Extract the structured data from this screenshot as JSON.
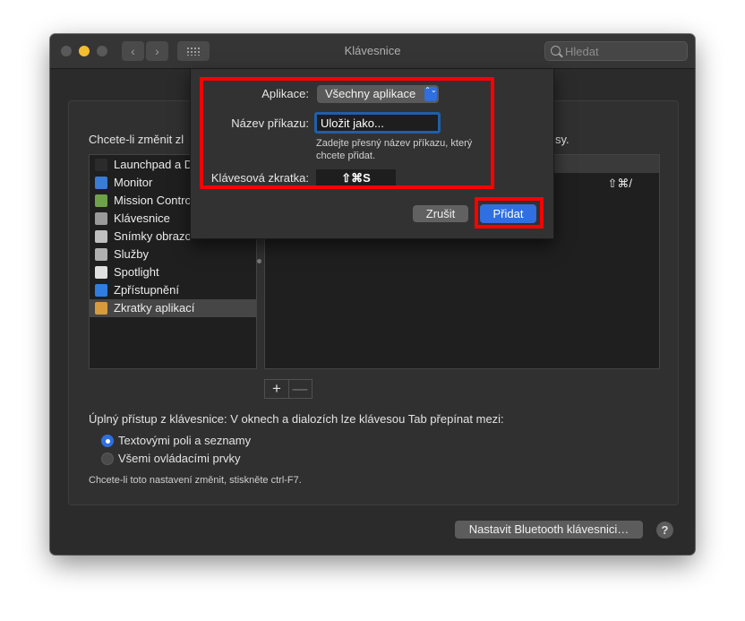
{
  "window": {
    "title": "Klávesnice",
    "search_placeholder": "Hledat",
    "nav_back": "‹",
    "nav_forward": "›"
  },
  "panel": {
    "hint_start": "Chcete-li změnit zl",
    "hint_end": "sy.",
    "sidebar_items": [
      {
        "label": "Launchpad a D",
        "icon": "launchpad-icon",
        "color": "#2b2b2b"
      },
      {
        "label": "Monitor",
        "icon": "monitor-icon",
        "color": "#3a7bd5"
      },
      {
        "label": "Mission Contro",
        "icon": "mission-control-icon",
        "color": "#6fa04a"
      },
      {
        "label": "Klávesnice",
        "icon": "keyboard-icon",
        "color": "#9a9a9a"
      },
      {
        "label": "Snímky obrazo",
        "icon": "screenshot-icon",
        "color": "#c0c0c0"
      },
      {
        "label": "Služby",
        "icon": "services-gear-icon",
        "color": "#b0b0b0"
      },
      {
        "label": "Spotlight",
        "icon": "spotlight-icon",
        "color": "#e0e0e0"
      },
      {
        "label": "Zpřístupnění",
        "icon": "accessibility-icon",
        "color": "#2f7de1"
      },
      {
        "label": "Zkratky aplikací",
        "icon": "app-shortcuts-icon",
        "color": "#d79b3c"
      }
    ],
    "selected_index": 8,
    "detail_shortcut": "⇧⌘/",
    "plus": "+",
    "minus": "—"
  },
  "keyboard_access": {
    "heading": "Úplný přístup z klávesnice: V oknech a dialozích lze klávesou Tab přepínat mezi:",
    "option1": "Textovými poli a seznamy",
    "option2": "Všemi ovládacími prvky",
    "selected": 1,
    "note": "Chcete-li toto nastavení změnit, stiskněte ctrl-F7."
  },
  "bottom": {
    "bluetooth_button": "Nastavit Bluetooth klávesnici…",
    "help": "?"
  },
  "sheet": {
    "app_label": "Aplikace:",
    "app_value": "Všechny aplikace",
    "popup_arrows": "⌃⌄",
    "cmd_label": "Název příkazu:",
    "cmd_value": "Uložit jako...",
    "cmd_help": "Zadejte přesný název příkazu, který chcete přidat.",
    "shortcut_label": "Klávesová zkratka:",
    "shortcut_value": "⇧⌘S",
    "cancel": "Zrušit",
    "add": "Přidat"
  },
  "colors": {
    "accent": "#2f6fe0",
    "highlight": "#ff0000"
  }
}
